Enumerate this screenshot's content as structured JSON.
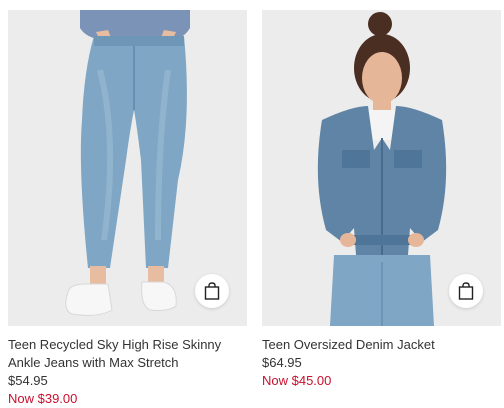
{
  "products": [
    {
      "name": "Teen Recycled Sky High Rise Skinny Ankle Jeans with Max Stretch",
      "price": "$54.95",
      "sale_price": "Now $39.00",
      "image_icon": "product-photo-jeans",
      "bag_icon": "shopping-bag-icon"
    },
    {
      "name": "Teen Oversized Denim Jacket",
      "price": "$64.95",
      "sale_price": "Now $45.00",
      "image_icon": "product-photo-denim-jacket",
      "bag_icon": "shopping-bag-icon"
    }
  ],
  "colors": {
    "sale": "#c8102e",
    "text": "#333333",
    "image_bg": "#ececec",
    "denim": "#7fa6c4"
  }
}
